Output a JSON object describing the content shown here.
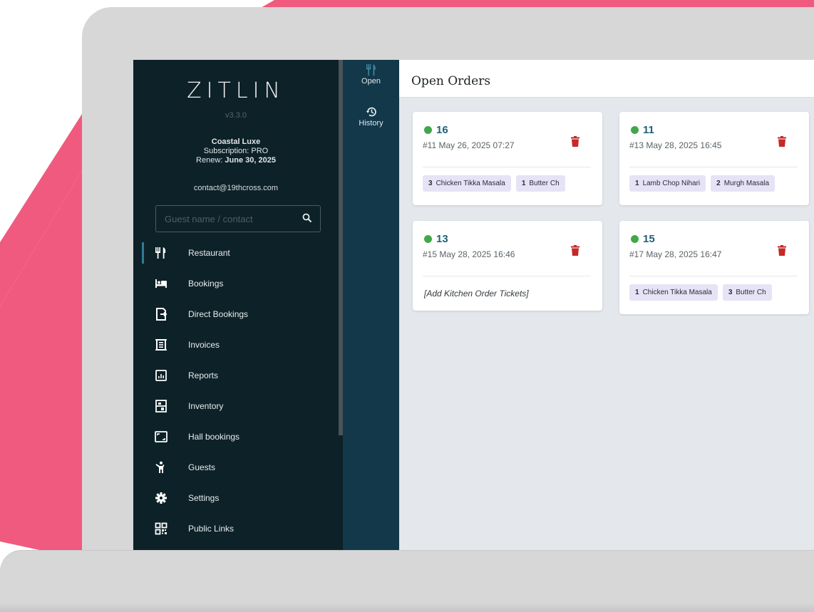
{
  "app": {
    "logo": "ZITLIN",
    "version": "v3.3.0",
    "org_name": "Coastal Luxe",
    "subscription": "Subscription: PRO",
    "renew_label": "Renew: ",
    "renew_date": "June 30, 2025",
    "contact": "contact@19thcross.com"
  },
  "search": {
    "placeholder": "Guest name / contact"
  },
  "nav": [
    {
      "label": "Restaurant",
      "icon": "fork-knife-icon"
    },
    {
      "label": "Bookings",
      "icon": "bed-icon"
    },
    {
      "label": "Direct Bookings",
      "icon": "direct-booking-icon"
    },
    {
      "label": "Invoices",
      "icon": "invoice-icon"
    },
    {
      "label": "Reports",
      "icon": "report-icon"
    },
    {
      "label": "Inventory",
      "icon": "inventory-icon"
    },
    {
      "label": "Hall bookings",
      "icon": "hall-icon"
    },
    {
      "label": "Guests",
      "icon": "guest-icon"
    },
    {
      "label": "Settings",
      "icon": "gear-icon"
    },
    {
      "label": "Public Links",
      "icon": "qr-code-icon"
    }
  ],
  "rail": {
    "open": "Open",
    "history": "History"
  },
  "page": {
    "title": "Open Orders"
  },
  "orders": [
    {
      "table": "16",
      "meta": "#11 May 26, 2025 07:27",
      "items": [
        {
          "qty": "3",
          "name": "Chicken Tikka Masala"
        },
        {
          "qty": "1",
          "name": "Butter Ch"
        }
      ]
    },
    {
      "table": "11",
      "meta": "#13 May 28, 2025 16:45",
      "items": [
        {
          "qty": "1",
          "name": "Lamb Chop Nihari"
        },
        {
          "qty": "2",
          "name": "Murgh Masala"
        }
      ]
    },
    {
      "table": "13",
      "meta": "#15 May 28, 2025 16:46",
      "empty_text": "[Add Kitchen Order Tickets]"
    },
    {
      "table": "15",
      "meta": "#17 May 28, 2025 16:47",
      "items": [
        {
          "qty": "1",
          "name": "Chicken Tikka Masala"
        },
        {
          "qty": "3",
          "name": "Butter Ch"
        }
      ]
    }
  ],
  "colors": {
    "accent_pink": "#f05a7e",
    "sidebar_bg": "#0d2128",
    "rail_bg": "#12384a",
    "status_green": "#41a74a",
    "delete_red": "#c62828",
    "chip_bg": "#e6e3f6"
  }
}
